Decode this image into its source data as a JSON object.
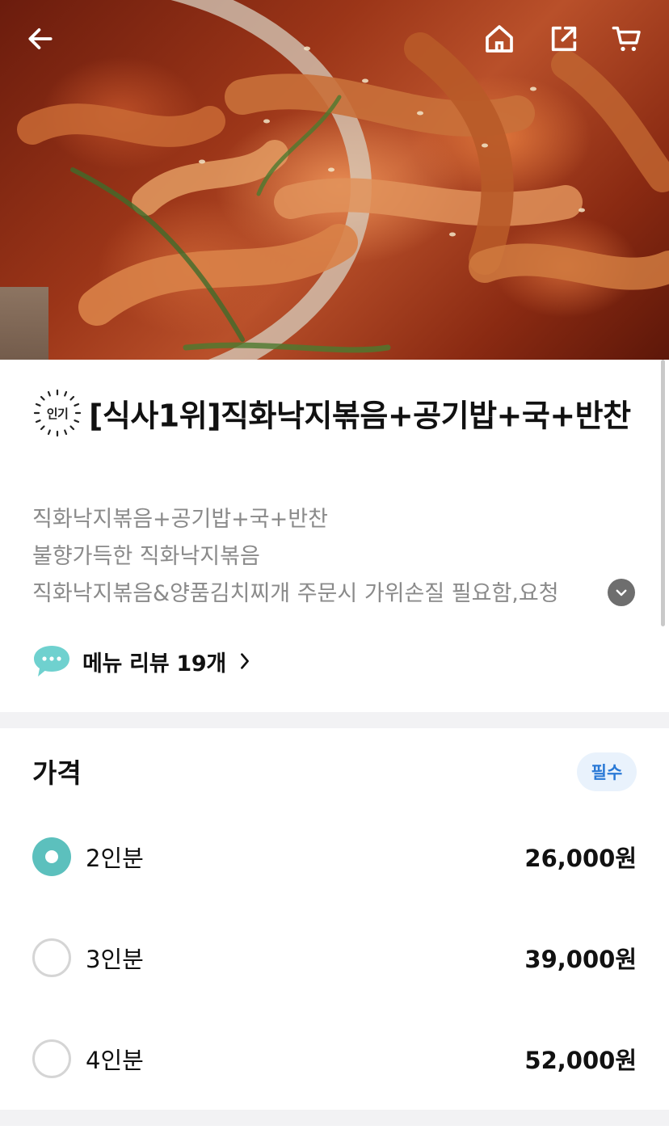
{
  "topbar": {
    "back_icon": "arrow-left-icon",
    "home_icon": "home-icon",
    "share_icon": "share-icon",
    "cart_icon": "cart-icon"
  },
  "product": {
    "badge": "인기",
    "title": "[식사1위]직화낙지볶음+공기밥+국+반찬",
    "description_lines": [
      "직화낙지볶음+공기밥+국+반찬",
      "불향가득한 직화낙지볶음",
      "직화낙지볶음&양품김치찌개 주문시 가위손질 필요함,요청"
    ],
    "review_link": "메뉴 리뷰 19개"
  },
  "price_section": {
    "heading": "가격",
    "required_badge": "필수",
    "options": [
      {
        "label": "2인분",
        "price": "26,000원",
        "selected": true
      },
      {
        "label": "3인분",
        "price": "39,000원",
        "selected": false
      },
      {
        "label": "4인분",
        "price": "52,000원",
        "selected": false
      }
    ]
  },
  "colors": {
    "accent": "#5cc0bd",
    "required_bg": "#e9f2fc",
    "required_text": "#2a79d6",
    "description_text": "#8a8a8a"
  }
}
